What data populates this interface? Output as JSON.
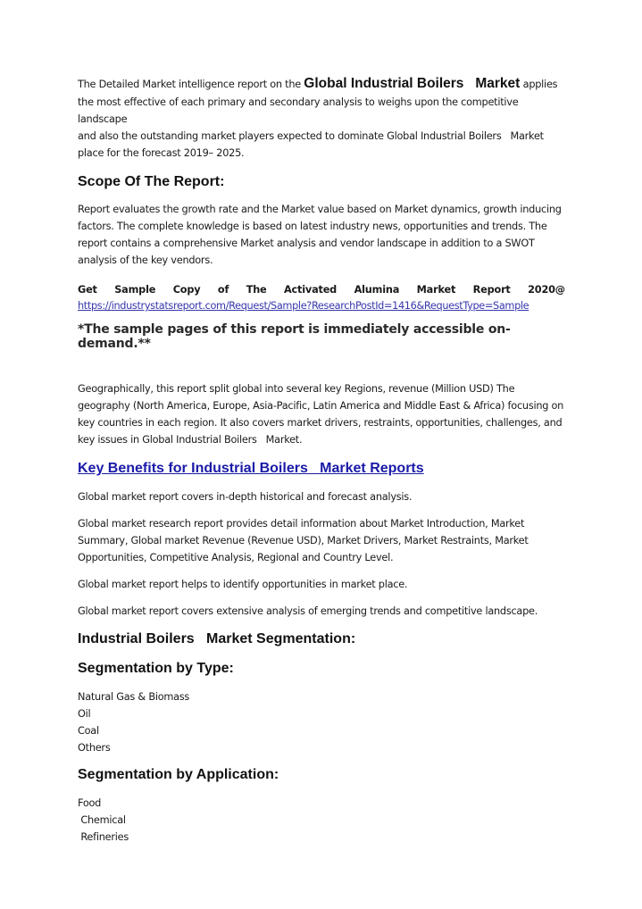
{
  "intro": {
    "prefix": "The Detailed Market intelligence report on the ",
    "highlight": "Global Industrial Boilers   Market",
    "suffix_first": " applies",
    "lines": [
      "the most effective of each primary and secondary analysis to weighs upon the competitive landscape",
      "and also the outstanding market players expected to dominate Global Industrial Boilers   Market",
      "place for the forecast 2019– 2025."
    ]
  },
  "scope": {
    "heading": "Scope Of The Report:",
    "lines": [
      "Report evaluates the growth rate and the Market value based on Market dynamics, growth inducing",
      "factors. The complete knowledge is based on latest industry news, opportunities and trends. The",
      "report contains a comprehensive Market analysis and vendor landscape in addition to a SWOT",
      "analysis of the key vendors."
    ]
  },
  "sample": {
    "words": [
      "Get",
      "Sample",
      "Copy",
      "of",
      "The",
      "Activated",
      "Alumina",
      "Market",
      "Report",
      "2020@"
    ],
    "link": "https://industrystatsreport.com/Request/Sample?ResearchPostId=1416&RequestType=Sample",
    "note": "*The sample pages of this report is immediately accessible on-demand.**"
  },
  "geography": {
    "lines": [
      "Geographically, this report split global into several key Regions, revenue (Million USD) The",
      "geography (North America, Europe, Asia-Pacific, Latin America and Middle East & Africa) focusing on",
      "key countries in each region. It also covers market drivers, restraints, opportunities, challenges, and",
      "key issues in Global Industrial Boilers   Market."
    ]
  },
  "key_benefits": {
    "heading": "Key Benefits for Industrial Boilers   Market Reports",
    "paragraphs": [
      [
        "Global market report covers in-depth historical and forecast analysis."
      ],
      [
        "Global market research report provides detail information about Market Introduction, Market",
        "Summary, Global market Revenue (Revenue USD), Market Drivers, Market Restraints, Market",
        "Opportunities, Competitive Analysis, Regional and Country Level."
      ],
      [
        "Global market report helps to identify opportunities in market place."
      ],
      [
        "Global market report covers extensive analysis of emerging trends and competitive landscape."
      ]
    ]
  },
  "segmentation": {
    "heading": "Industrial Boilers   Market Segmentation:",
    "by_type": {
      "heading": "Segmentation by Type:",
      "items": [
        "Natural Gas & Biomass",
        "Oil",
        "Coal",
        "Others"
      ]
    },
    "by_application": {
      "heading": "Segmentation by Application:",
      "items": [
        "Food",
        " Chemical",
        " Refineries"
      ]
    }
  },
  "colors": {
    "heading_link": "#1a1aa8",
    "url_link": "#3636ad",
    "text": "#1a1a1a"
  }
}
